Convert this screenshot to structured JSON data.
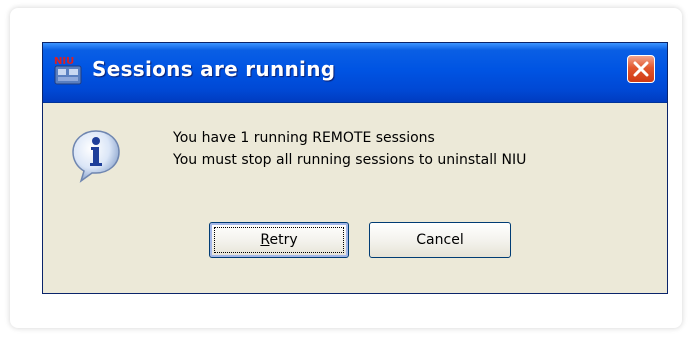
{
  "dialog": {
    "title": "Sessions are running",
    "app_icon": "niu-app-icon",
    "close_icon": "close-icon",
    "info_icon": "info-icon",
    "message_line1": "You have 1 running REMOTE sessions",
    "message_line2": "You must stop all running sessions to uninstall NIU",
    "buttons": {
      "retry_mnemonic": "R",
      "retry_rest": "etry",
      "cancel_label": "Cancel"
    }
  },
  "colors": {
    "titlebar": "#0054e3",
    "dialog_bg": "#ece9d8",
    "close_button": "#e2572e"
  }
}
